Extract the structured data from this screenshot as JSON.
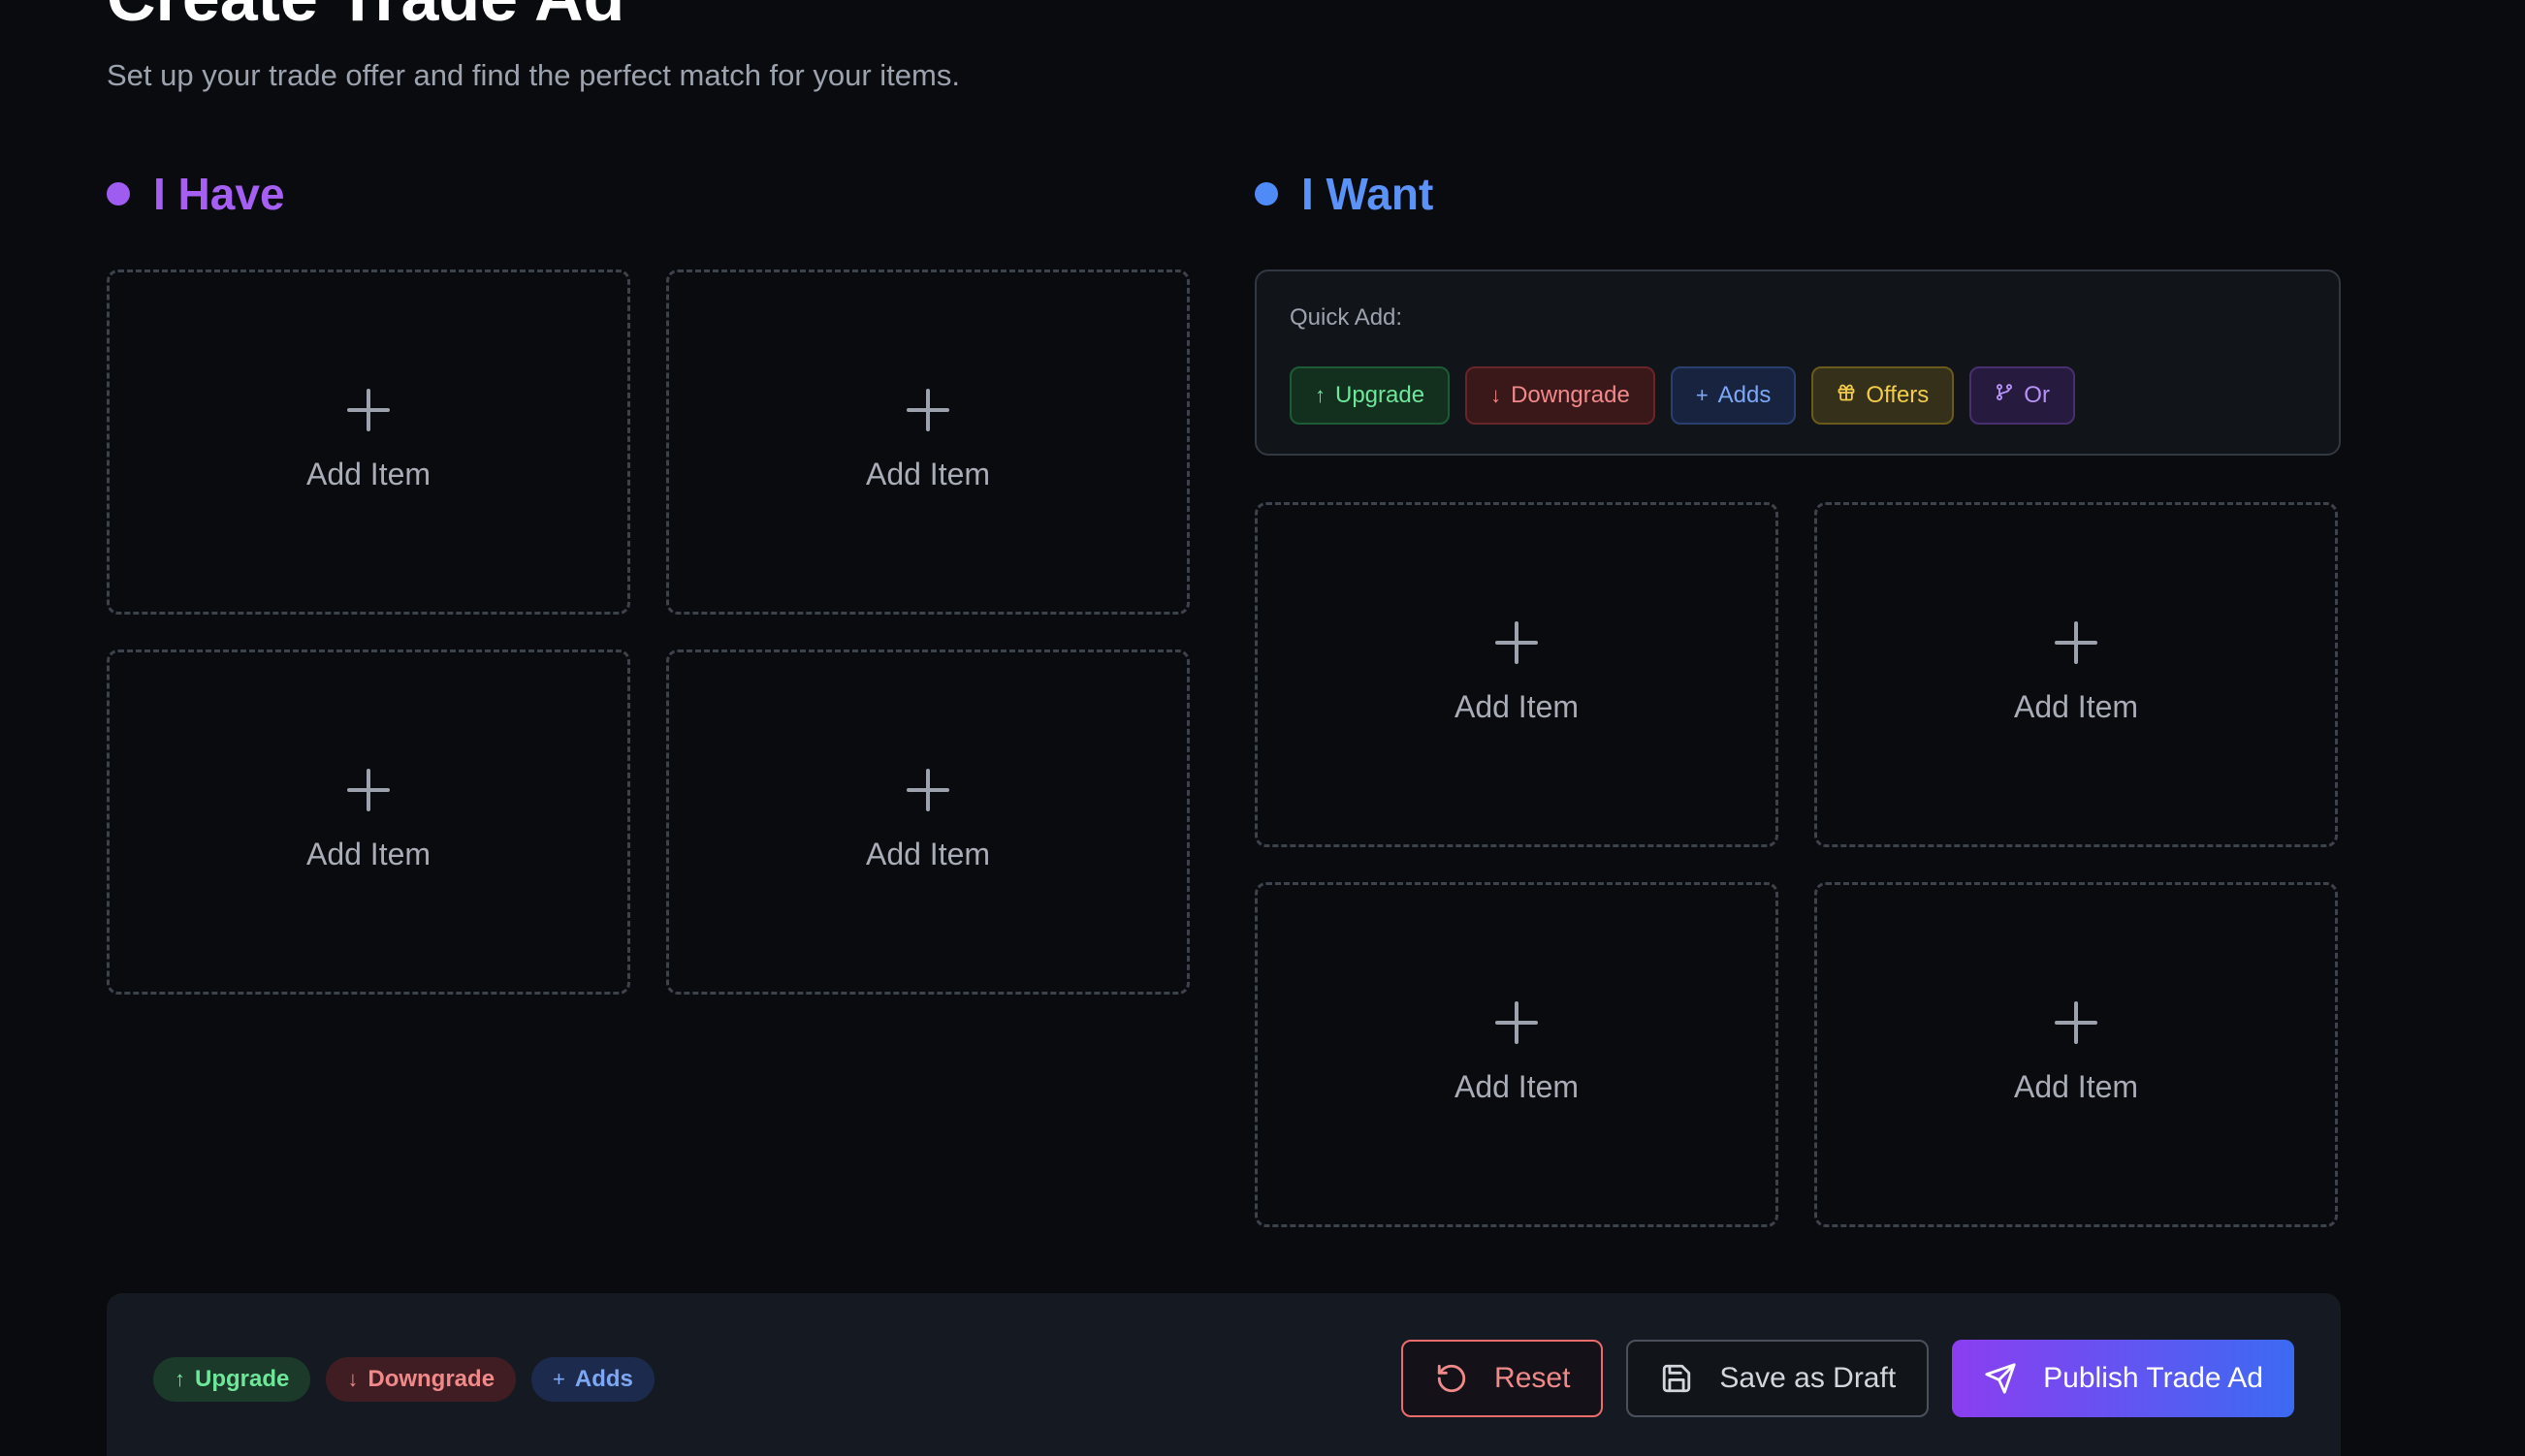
{
  "page": {
    "title": "Create Trade Ad",
    "subtitle": "Set up your trade offer and find the perfect match for your items."
  },
  "have": {
    "heading": "I Have",
    "accent": "#9f5cf0",
    "slots": [
      "Add Item",
      "Add Item",
      "Add Item",
      "Add Item"
    ]
  },
  "want": {
    "heading": "I Want",
    "accent": "#4f8bf6",
    "quick_add": {
      "label": "Quick Add:",
      "chips": [
        {
          "icon": "arrow-up-icon",
          "label": "Upgrade",
          "color": "green"
        },
        {
          "icon": "arrow-down-icon",
          "label": "Downgrade",
          "color": "red"
        },
        {
          "icon": "plus-icon",
          "label": "Adds",
          "color": "blue"
        },
        {
          "icon": "gift-icon",
          "label": "Offers",
          "color": "yellow"
        },
        {
          "icon": "branch-icon",
          "label": "Or",
          "color": "purple"
        }
      ]
    },
    "slots": [
      "Add Item",
      "Add Item",
      "Add Item",
      "Add Item"
    ]
  },
  "footer": {
    "tags": [
      {
        "icon": "arrow-up-icon",
        "label": "Upgrade",
        "color": "green"
      },
      {
        "icon": "arrow-down-icon",
        "label": "Downgrade",
        "color": "red"
      },
      {
        "icon": "plus-icon",
        "label": "Adds",
        "color": "blue"
      }
    ],
    "reset_label": "Reset",
    "draft_label": "Save as Draft",
    "publish_label": "Publish Trade Ad"
  }
}
